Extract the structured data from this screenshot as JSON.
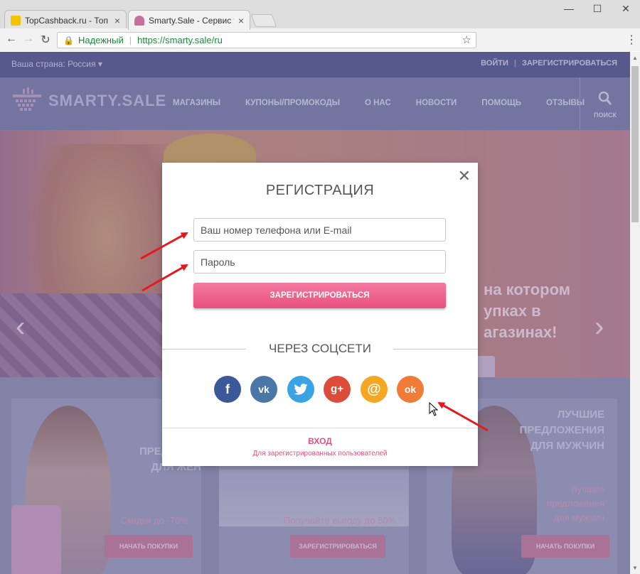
{
  "browser": {
    "tabs": [
      {
        "title": "TopCashback.ru - Топ лу",
        "active": false
      },
      {
        "title": "Smarty.Sale - Сервис ум",
        "active": true
      }
    ],
    "secure_label": "Надежный",
    "url": "https://smarty.sale/ru",
    "window_controls": {
      "minimize": "—",
      "maximize": "☐",
      "close": "✕"
    }
  },
  "site": {
    "country": "Ваша страна: Россия",
    "login_link": "ВОЙТИ",
    "register_link": "ЗАРЕГИСТРИРОВАТЬСЯ",
    "logo_text": "SMARTY.SALE",
    "nav": [
      "МАГАЗИНЫ",
      "КУПОНЫ/ПРОМОКОДЫ",
      "О НАС",
      "НОВОСТИ",
      "ПОМОЩЬ",
      "ОТЗЫВЫ"
    ],
    "search_label": "ПОИСК",
    "hero_text": [
      "на котором",
      "упках в",
      "агазинах!"
    ],
    "cards": [
      {
        "title": [
          "ЛУЧ",
          "ПРЕДЛОЖЕ",
          "ДЛЯ ЖЕН"
        ],
        "subtitle": "Скидки до -70%",
        "button": "НАЧАТЬ ПОКУПКИ"
      },
      {
        "title": [],
        "subtitle": "Получайте выгоду до 50%",
        "button": "ЗАРЕГИСТРИРОВАТЬСЯ"
      },
      {
        "title": [
          "ЛУЧШИЕ",
          "ПРЕДЛОЖЕНИЯ",
          "ДЛЯ МУЖЧИН"
        ],
        "subtitle": "Лучшие предложения для мужчин",
        "button": "НАЧАТЬ ПОКУПКИ"
      }
    ]
  },
  "modal": {
    "title": "РЕГИСТРАЦИЯ",
    "close": "✕",
    "login_placeholder": "Ваш номер телефона или E-mail",
    "password_placeholder": "Пароль",
    "submit": "ЗАРЕГИСТРИРОВАТЬСЯ",
    "social_title": "ЧЕРЕЗ СОЦСЕТИ",
    "social": [
      {
        "name": "facebook",
        "glyph": "f",
        "color": "#3b5998"
      },
      {
        "name": "vkontakte",
        "glyph": "vk",
        "color": "#4a76a8"
      },
      {
        "name": "twitter",
        "glyph": "t",
        "color": "#3aa3e3"
      },
      {
        "name": "google-plus",
        "glyph": "g+",
        "color": "#dd4b39"
      },
      {
        "name": "mail-ru",
        "glyph": "@",
        "color": "#f5a623"
      },
      {
        "name": "odnoklassniki",
        "glyph": "ok",
        "color": "#f07b36"
      }
    ],
    "login_title": "ВХОД",
    "login_subtitle": "Для зарегистрированных пользователей"
  },
  "colors": {
    "accent": "#e8507e",
    "annotation": "#e8171d"
  }
}
